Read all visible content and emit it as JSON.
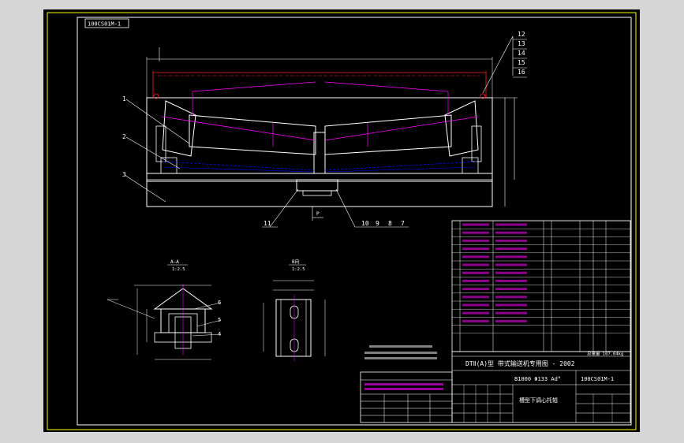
{
  "drawing_number_box": "100CS01M-1",
  "title_block": {
    "drawing_title": "DTⅡ(A)型 带式输送机专用图 - 2002",
    "spec": "B1000 Φ133 Ad°",
    "drawing_code": "100CS01M-1",
    "part_name": "槽型下调心托辊",
    "weight_label": "总重量 107.04kg"
  },
  "part_callouts": [
    "1",
    "2",
    "3",
    "11",
    "10",
    "9",
    "8",
    "7",
    "12",
    "13",
    "14",
    "15",
    "16",
    "4",
    "5",
    "6"
  ],
  "section_labels": {
    "section_aa": "A—A",
    "section_aa_scale": "1:2.5",
    "view_b": "B向",
    "view_b_scale": "1:2.5",
    "view_a_marker": "A",
    "view_p_marker": "P"
  },
  "parts_table": {
    "rows_count": 13
  },
  "colors": {
    "sheet": "#000000",
    "outline": "#ffffff",
    "frame": "#ffff00",
    "roller_axis": "#ff00ff",
    "dimension": "#ff2020",
    "hidden": "#0000ff"
  }
}
